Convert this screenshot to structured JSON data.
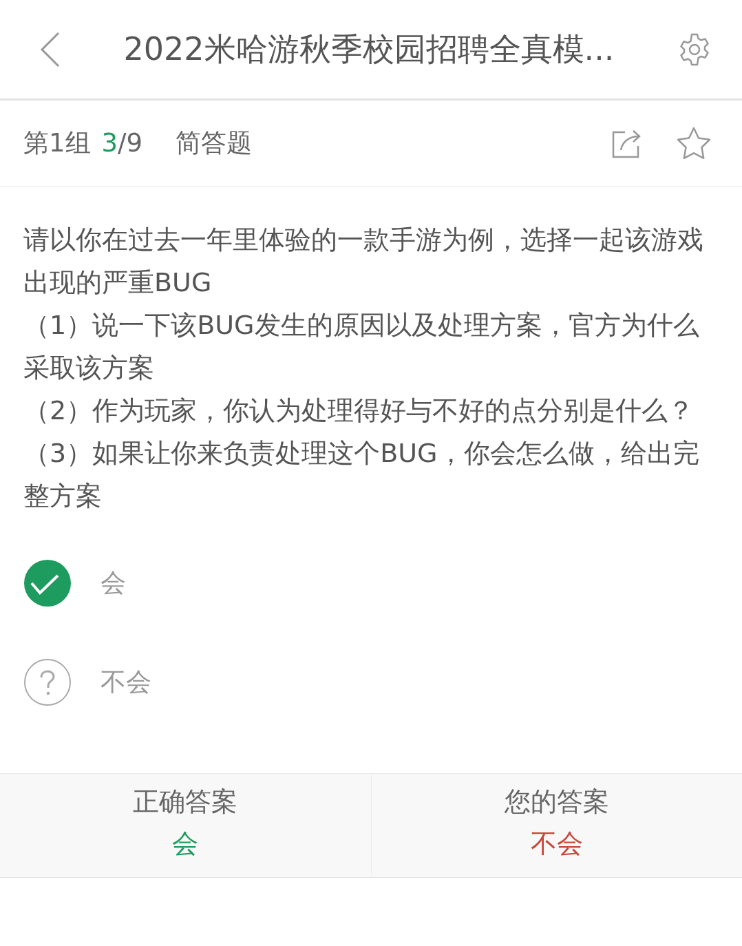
{
  "header": {
    "title": "2022米哈游秋季校园招聘全真模..."
  },
  "info_bar": {
    "group": "第1组",
    "current": "3",
    "total": "/9",
    "type": "简答题",
    "favorited": false
  },
  "question": {
    "paragraphs": [
      "请以你在过去一年里体验的一款手游为例，选择一起该游戏出现的严重BUG",
      "（1）说一下该BUG发生的原因以及处理方案，官方为什么采取该方案",
      "（2）作为玩家，你认为处理得好与不好的点分别是什么？",
      "（3）如果让你来负责处理这个BUG，你会怎么做，给出完整方案"
    ]
  },
  "options": [
    {
      "label": "会",
      "selected": true
    },
    {
      "label": "不会",
      "selected": false
    }
  ],
  "answers": [
    {
      "heading": "正确答案",
      "value": "会",
      "correct": true
    },
    {
      "heading": "您的答案",
      "value": "不会",
      "correct": false
    }
  ]
}
